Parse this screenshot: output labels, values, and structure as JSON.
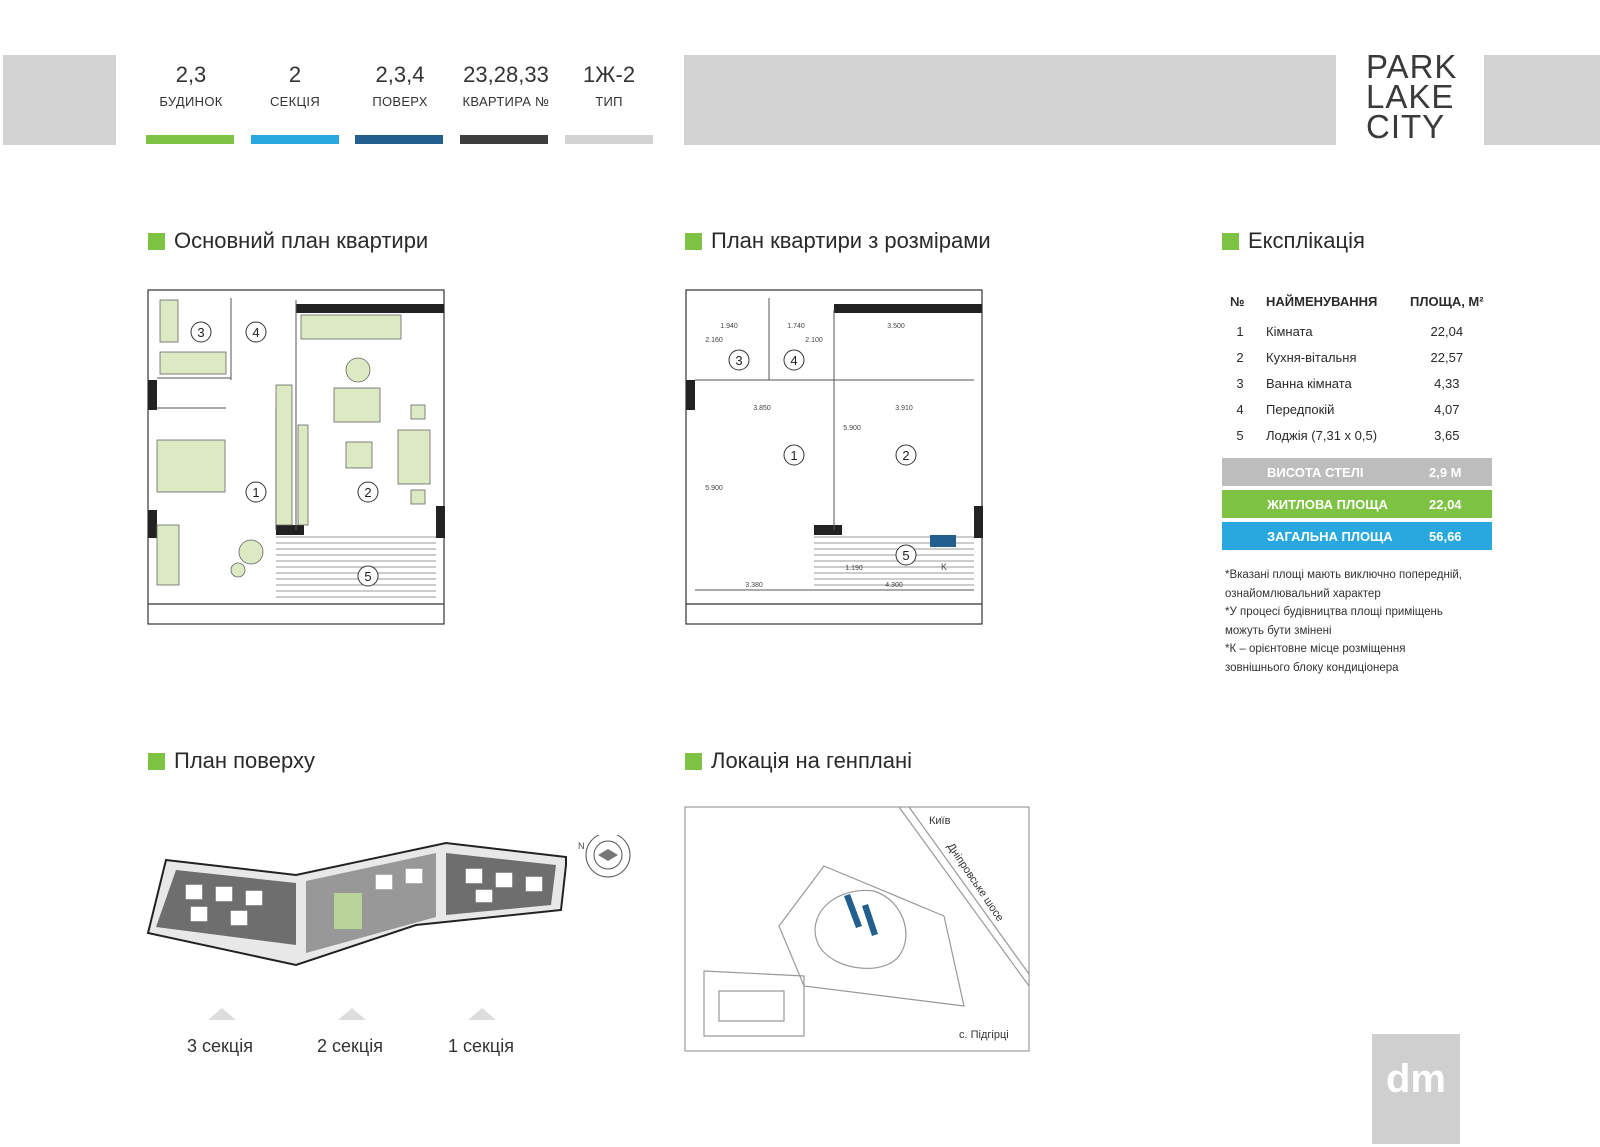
{
  "header": {
    "items": [
      {
        "value": "2,3",
        "label": "БУДИНОК",
        "color": "#7dc242"
      },
      {
        "value": "2",
        "label": "СЕКЦІЯ",
        "color": "#29a8e0"
      },
      {
        "value": "2,3,4",
        "label": "ПОВЕРХ",
        "color": "#225f8e"
      },
      {
        "value": "23,28,33",
        "label": "КВАРТИРА №",
        "color": "#3d3d3d"
      },
      {
        "value": "1Ж-2",
        "label": "ТИП",
        "color": "#d3d3d3"
      }
    ],
    "logo": [
      "PARK",
      "LAKE",
      "CITY"
    ]
  },
  "sections": {
    "main_plan": "Основний план квартири",
    "dim_plan": "План квартири з розмірами",
    "explication": "Експлікація",
    "floor_plan": "План поверху",
    "location": "Локація на генплані"
  },
  "explication": {
    "headers": [
      "№",
      "НАЙМЕНУВАННЯ",
      "ПЛОЩА, М²"
    ],
    "rows": [
      {
        "n": "1",
        "name": "Кімната",
        "area": "22,04"
      },
      {
        "n": "2",
        "name": "Кухня-вітальня",
        "area": "22,57"
      },
      {
        "n": "3",
        "name": "Ванна кімната",
        "area": "4,33"
      },
      {
        "n": "4",
        "name": "Передпокій",
        "area": "4,07"
      },
      {
        "n": "5",
        "name": "Лоджія (7,31 x 0,5)",
        "area": "3,65"
      }
    ],
    "stats": [
      {
        "label": "ВИСОТА СТЕЛІ",
        "value": "2,9 М",
        "color": "#bdbdbd"
      },
      {
        "label": "ЖИТЛОВА ПЛОЩА",
        "value": "22,04",
        "color": "#7dc242"
      },
      {
        "label": "ЗАГАЛЬНА ПЛОЩА",
        "value": "56,66",
        "color": "#29a8e0"
      }
    ],
    "notes": [
      "*Вказані площі мають виключно попередній,",
      "ознайомлювальний характер",
      "*У процесі будівництва площі приміщень",
      "можуть бути змінені",
      "*К – орієнтовне місце розміщення",
      "зовнішнього блоку кондиціонера"
    ]
  },
  "plan_labels": {
    "rooms": [
      "1",
      "2",
      "3",
      "4",
      "5"
    ],
    "dims": [
      "1.940",
      "1.740",
      "3.500",
      "2.160",
      "2.100",
      "3.850",
      "3.910",
      "5.900",
      "5.900",
      "3.380",
      "4.300",
      "1.190"
    ],
    "ac_mark": "K",
    "compass": "N"
  },
  "floor_sections": [
    "3 секція",
    "2 секція",
    "1 секція"
  ],
  "location_labels": {
    "city": "Київ",
    "road": "Дніпровське шосе",
    "village": "с. Підгірці"
  },
  "developer_logo": "dm"
}
